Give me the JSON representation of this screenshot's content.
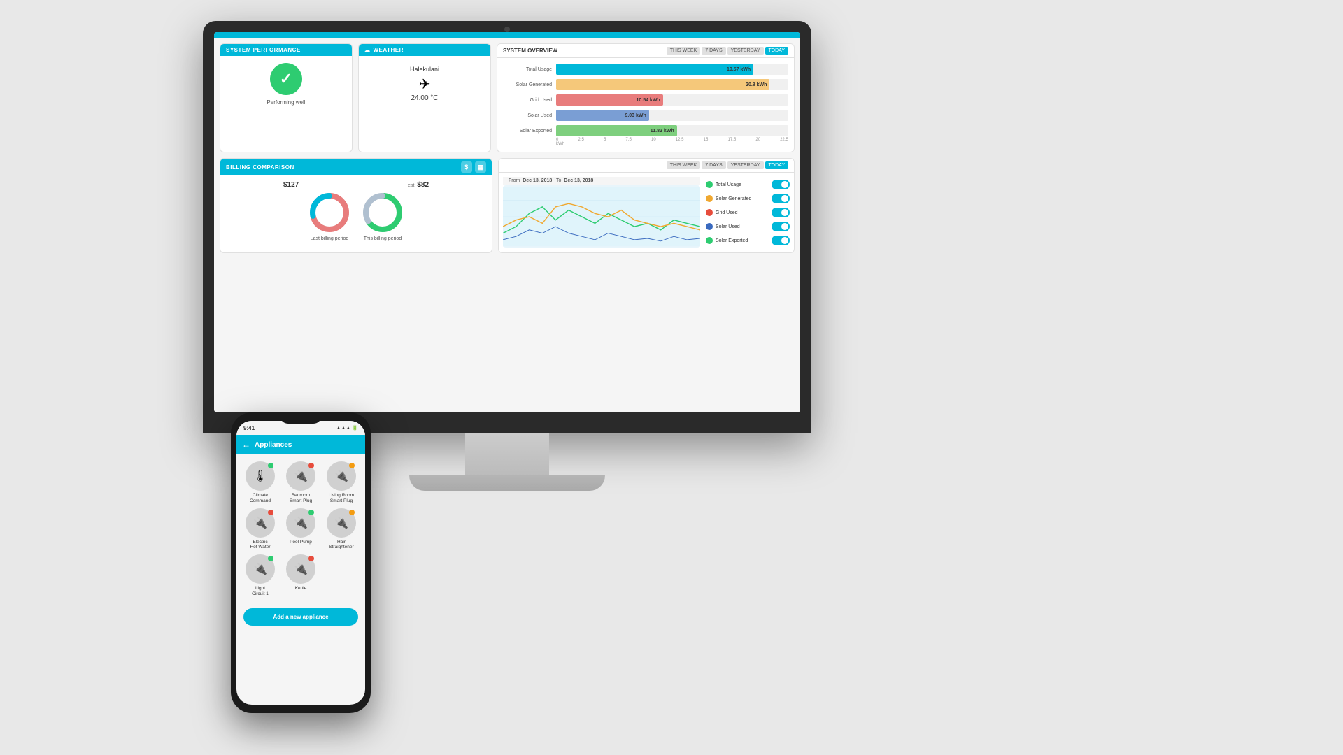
{
  "scene": {
    "background": "#e8e8e8"
  },
  "monitor": {
    "topbar_color": "#00b8d9"
  },
  "system_performance": {
    "header": "SYSTEM PERFORMANCE",
    "status": "Performing well"
  },
  "weather": {
    "header": "WEATHER",
    "location": "Halekulani",
    "temperature": "24.00 °C",
    "icon": "✈"
  },
  "billing": {
    "header": "BILLING COMPARISON",
    "last_amount": "$127",
    "est_label": "est.",
    "this_amount": "$82",
    "last_period_label": "Last billing period",
    "this_period_label": "This billing period"
  },
  "system_overview": {
    "header": "SYSTEM OVERVIEW",
    "tabs": [
      "THIS WEEK",
      "7 DAYS",
      "YESTERDAY",
      "TODAY"
    ],
    "active_tab": "TODAY",
    "bars": [
      {
        "label": "Total Usage",
        "value": "19.57 kWh",
        "pct": 85,
        "color": "#00b8d9"
      },
      {
        "label": "Solar Generated",
        "value": "20.8 kWh",
        "pct": 92,
        "color": "#f5c87a"
      },
      {
        "label": "Grid Used",
        "value": "10.54 kWh",
        "pct": 46,
        "color": "#e87c7c"
      },
      {
        "label": "Solar Used",
        "value": "9.03 kWh",
        "pct": 40,
        "color": "#7a9ed4"
      },
      {
        "label": "Solar Exported",
        "value": "11.82 kWh",
        "pct": 52,
        "color": "#7ecf7e"
      }
    ],
    "axis_labels": [
      "0",
      "2.5",
      "5",
      "7.5",
      "10",
      "12.5",
      "15",
      "17.5",
      "20",
      "22.5"
    ],
    "axis_unit": "kWh"
  },
  "bottom_chart": {
    "tabs": [
      "THIS WEEK",
      "7 DAYS",
      "YESTERDAY",
      "TODAY"
    ],
    "active_tab": "TODAY",
    "date_from": "Dec 13, 2018",
    "date_to": "Dec 13, 2018",
    "legend": [
      {
        "label": "Total Usage",
        "color": "#2ecc71",
        "enabled": true
      },
      {
        "label": "Solar Generated",
        "color": "#f0a830",
        "enabled": true
      },
      {
        "label": "Grid Used",
        "color": "#e74c3c",
        "enabled": true
      },
      {
        "label": "Solar Used",
        "color": "#3a6abf",
        "enabled": true
      },
      {
        "label": "Solar Exported",
        "color": "#2ecc71",
        "enabled": true
      }
    ]
  },
  "phone": {
    "time": "9:41",
    "title": "Appliances",
    "back_arrow": "←",
    "appliances": [
      {
        "name": "Climate\nCommand",
        "icon": "🌡",
        "dot": "green"
      },
      {
        "name": "Bedroom\nSmart Plug",
        "icon": "🔌",
        "dot": "red"
      },
      {
        "name": "Living Room\nSmart Plug",
        "icon": "🔌",
        "dot": "orange"
      },
      {
        "name": "Electric\nHot Water",
        "icon": "🔌",
        "dot": "red"
      },
      {
        "name": "Pool Pump",
        "icon": "🔌",
        "dot": "green"
      },
      {
        "name": "Hair\nStraightener",
        "icon": "🔌",
        "dot": "orange"
      },
      {
        "name": "Light\nCircuit 1",
        "icon": "🔌",
        "dot": "green"
      },
      {
        "name": "Kettle",
        "icon": "🔌",
        "dot": "red"
      }
    ],
    "add_button_label": "Add a new appliance"
  }
}
